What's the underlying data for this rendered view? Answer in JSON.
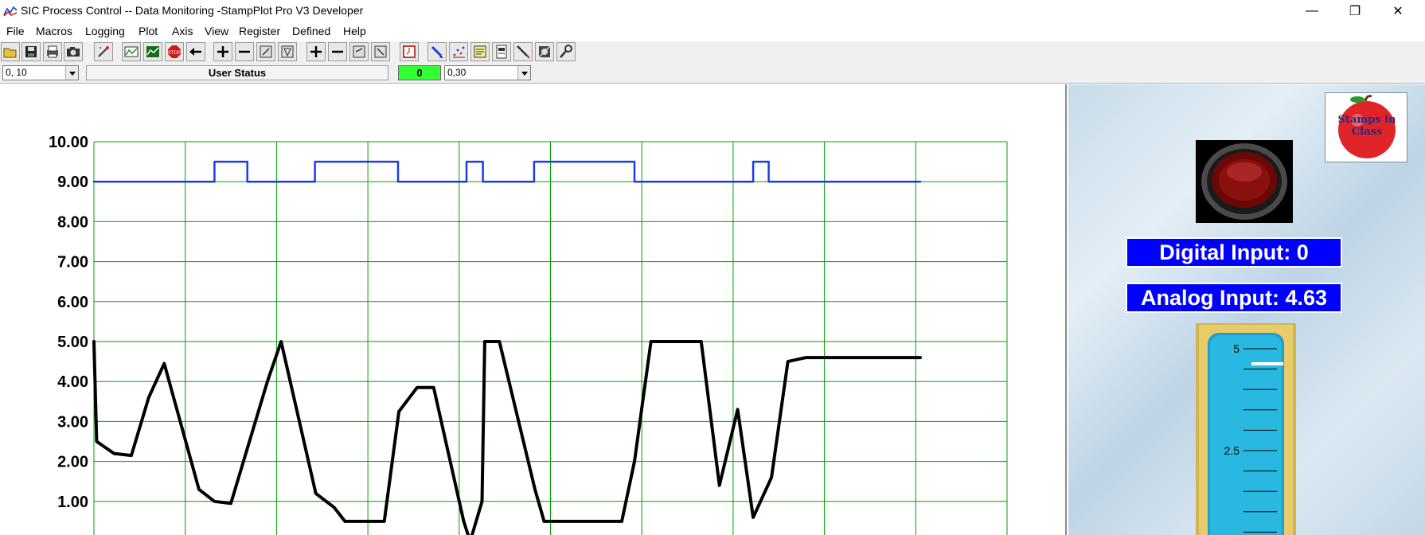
{
  "window": {
    "title": "SIC Process Control -- Data Monitoring  -StampPlot Pro V3 Developer",
    "controls": {
      "minimize": "—",
      "restore": "❐",
      "close": "✕"
    }
  },
  "menu": [
    "File",
    "Macros",
    "Logging",
    "Plot",
    "Axis",
    "View",
    "Register",
    "Defined",
    "Help"
  ],
  "toolbar_icons": [
    "open-icon",
    "save-icon",
    "print-icon",
    "snapshot-icon",
    "clear-icon",
    "connect-icon",
    "plot-icon",
    "stop-icon",
    "back-arrow-icon",
    "zoom-in-icon",
    "zoom-out-icon",
    "axis-expand-icon",
    "axis-shrink-icon",
    "zoom-in-icon",
    "zoom-out-icon",
    "axis-left-icon",
    "axis-right-icon",
    "clock-icon",
    "pen-icon",
    "points-icon",
    "notes-icon",
    "log-icon",
    "probe-icon",
    "settings-icon",
    "wrench-icon"
  ],
  "status": {
    "y_range": "0, 10",
    "user_status": "User Status",
    "count": "0",
    "x_range": "0,30"
  },
  "chart_data": {
    "type": "line",
    "title": "",
    "xlabel": "",
    "ylabel": "",
    "xlim": [
      0,
      10
    ],
    "ylim": [
      0,
      10
    ],
    "grid": true,
    "grid_color": "#00a000",
    "y_ticks": [
      "1.00",
      "2.00",
      "3.00",
      "4.00",
      "5.00",
      "6.00",
      "7.00",
      "8.00",
      "9.00",
      "10.00"
    ],
    "series": [
      {
        "color": "#1a3ce6",
        "points": [
          [
            0,
            9.0
          ],
          [
            1.32,
            9.0
          ],
          [
            1.32,
            9.5
          ],
          [
            1.68,
            9.5
          ],
          [
            1.68,
            9.0
          ],
          [
            2.42,
            9.0
          ],
          [
            2.42,
            9.5
          ],
          [
            3.33,
            9.5
          ],
          [
            3.33,
            9.0
          ],
          [
            4.08,
            9.0
          ],
          [
            4.08,
            9.5
          ],
          [
            4.26,
            9.5
          ],
          [
            4.26,
            9.0
          ],
          [
            4.82,
            9.0
          ],
          [
            4.82,
            9.5
          ],
          [
            5.92,
            9.5
          ],
          [
            5.92,
            9.0
          ],
          [
            7.22,
            9.0
          ],
          [
            7.22,
            9.5
          ],
          [
            7.39,
            9.5
          ],
          [
            7.39,
            9.0
          ],
          [
            9.05,
            9.0
          ]
        ]
      },
      {
        "color": "#000000",
        "points": [
          [
            0,
            5.0
          ],
          [
            0.03,
            2.5
          ],
          [
            0.22,
            2.2
          ],
          [
            0.41,
            2.15
          ],
          [
            0.6,
            3.6
          ],
          [
            0.77,
            4.45
          ],
          [
            1.15,
            1.3
          ],
          [
            1.32,
            1.0
          ],
          [
            1.5,
            0.95
          ],
          [
            1.9,
            4.0
          ],
          [
            2.05,
            5.0
          ],
          [
            2.43,
            1.2
          ],
          [
            2.63,
            0.85
          ],
          [
            2.75,
            0.5
          ],
          [
            3.18,
            0.5
          ],
          [
            3.34,
            3.25
          ],
          [
            3.54,
            3.85
          ],
          [
            3.72,
            3.85
          ],
          [
            4.05,
            0.5
          ],
          [
            4.12,
            0.0
          ],
          [
            4.25,
            1.0
          ],
          [
            4.28,
            5.0
          ],
          [
            4.44,
            5.0
          ],
          [
            4.83,
            1.3
          ],
          [
            4.93,
            0.5
          ],
          [
            5.78,
            0.5
          ],
          [
            5.92,
            2.0
          ],
          [
            6.1,
            5.0
          ],
          [
            6.65,
            5.0
          ],
          [
            6.85,
            1.4
          ],
          [
            7.05,
            3.3
          ],
          [
            7.22,
            0.6
          ],
          [
            7.42,
            1.6
          ],
          [
            7.6,
            4.5
          ],
          [
            7.8,
            4.6
          ],
          [
            9.05,
            4.6
          ]
        ]
      }
    ]
  },
  "side": {
    "logo_text": "Stamps in Class",
    "digital_input": "Digital Input: 0",
    "analog_input": "Analog Input: 4.63",
    "tank": {
      "max_label": "5",
      "mid_label": "2.5",
      "level": 4.63,
      "max": 5
    }
  },
  "colors": {
    "info_box": "#0000ff",
    "count_box": "#33ff33",
    "tank": "#29b8e0",
    "tank_frame": "#d2b451"
  }
}
